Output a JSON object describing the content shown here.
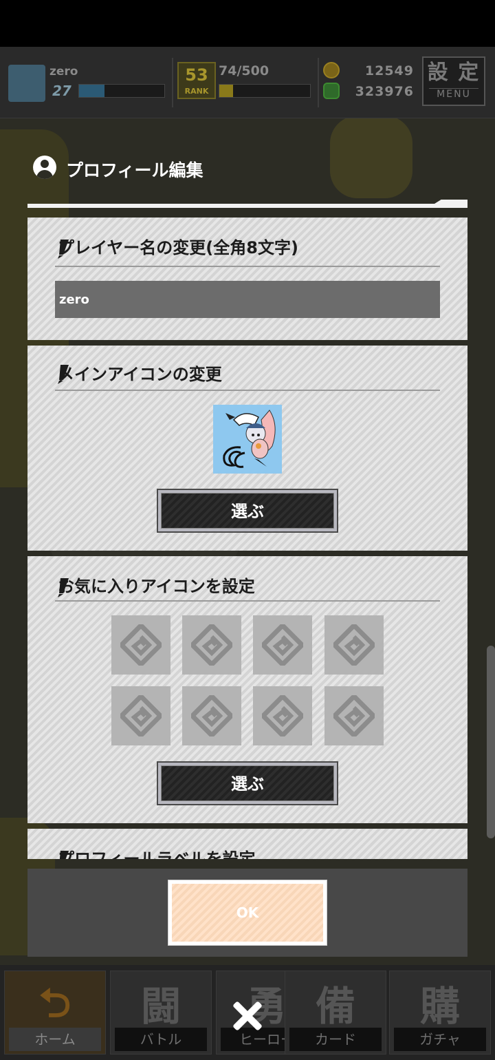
{
  "header": {
    "player_name": "zero",
    "player_level": "27",
    "rank_number": "53",
    "rank_label": "RANK",
    "stamina": "74/500",
    "coins": "12549",
    "gems": "323976",
    "menu_kanji": "設 定",
    "menu_label": "MENU"
  },
  "dialog": {
    "title": "プロフィール編集",
    "sections": {
      "player_name": {
        "title": "プレイヤー名の変更(全角8文字)",
        "value": "zero"
      },
      "main_icon": {
        "title": "メインアイコンの変更",
        "button": "選ぶ"
      },
      "favorite_icons": {
        "title": "お気に入りアイコンを設定",
        "button": "選ぶ",
        "slot_count": 8
      },
      "profile_label": {
        "title": "プロフィールラベルを設定"
      }
    },
    "ok_button": "OK"
  },
  "bottom_nav": [
    {
      "glyph": "",
      "label": "ホーム"
    },
    {
      "glyph": "闘",
      "label": "バトル"
    },
    {
      "glyph": "勇",
      "label": "ヒーロー"
    },
    {
      "glyph": "備",
      "label": "カード"
    },
    {
      "glyph": "購",
      "label": "ガチャ"
    }
  ],
  "colors": {
    "panel_bg": "#dcdcdc",
    "input_bg": "#6c6c6c",
    "ok_button": "#ffdfc4",
    "main_icon_bg": "#8ec8ef"
  },
  "icons": [
    "user-circle-icon",
    "pencil-icon",
    "placeholder-icon",
    "close-icon",
    "coin-icon",
    "gem-icon"
  ]
}
